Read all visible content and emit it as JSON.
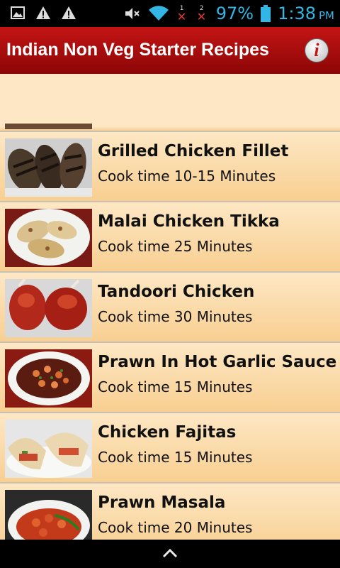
{
  "status": {
    "battery": "97%",
    "time": "1:38",
    "ampm": "PM",
    "sim1": "1",
    "sim2": "2",
    "icons": [
      "image-icon",
      "warning-icon",
      "warning-icon",
      "mute-icon",
      "wifi-icon",
      "sim1-no-signal-icon",
      "sim2-no-signal-icon",
      "battery-icon"
    ]
  },
  "header": {
    "title": "Indian Non Veg Starter Recipes",
    "info_icon": "info-icon",
    "info_glyph": "i"
  },
  "recipes": [
    {
      "name": "Grilled Chicken Fillet",
      "time": "Cook time 10-15 Minutes"
    },
    {
      "name": "Malai Chicken Tikka",
      "time": "Cook time 25 Minutes"
    },
    {
      "name": "Tandoori Chicken",
      "time": "Cook time 30 Minutes"
    },
    {
      "name": "Prawn In Hot Garlic Sauce",
      "time": "Cook time 15 Minutes"
    },
    {
      "name": "Chicken Fajitas",
      "time": "Cook time 15 Minutes"
    },
    {
      "name": "Prawn Masala",
      "time": "Cook time 20 Minutes"
    }
  ],
  "colors": {
    "action_bar": "#b00b0b",
    "list_bg": "#fde7c4",
    "status_accent": "#33b5e5"
  }
}
